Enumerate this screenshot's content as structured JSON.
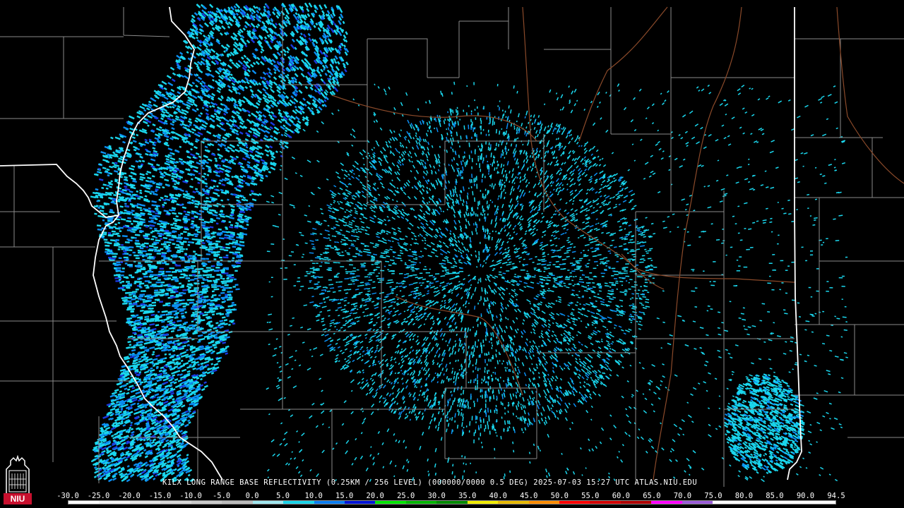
{
  "caption": "KILX LONG RANGE BASE REFLECTIVITY (0.25KM / 256 LEVEL) (000000/0000 0.5 DEG) 2025-07-03 15:27 UTC  ATLAS.NIU.EDU",
  "logo_text": "NIU",
  "scale": {
    "labels": [
      "-30.0",
      "-25.0",
      "-20.0",
      "-15.0",
      "-10.0",
      "-5.0",
      "0.0",
      "5.0",
      "10.0",
      "15.0",
      "20.0",
      "25.0",
      "30.0",
      "35.0",
      "40.0",
      "45.0",
      "50.0",
      "55.0",
      "60.0",
      "65.0",
      "70.0",
      "75.0",
      "80.0",
      "85.0",
      "90.0",
      "94.5"
    ],
    "colors": [
      "#ffffff",
      "#f2f2f2",
      "#e4e4e4",
      "#d6d6d6",
      "#c8c8c8",
      "#bababa",
      "#9fe6ee",
      "#19d2e8",
      "#0a7cf0",
      "#0014d8",
      "#00e400",
      "#00b400",
      "#008a00",
      "#f0ec00",
      "#e6b800",
      "#ff8c00",
      "#ff0000",
      "#d40000",
      "#b00000",
      "#ff00ff",
      "#9a5cd8",
      "#ffffff",
      "#ffffff",
      "#ffffff",
      "#ffffff"
    ]
  },
  "colors": {
    "background": "#000000",
    "county_lines": "#8a8a8a",
    "state_lines": "#ffffff",
    "rivers": "#8b4a2a",
    "echo_light": "#1ad7ee",
    "echo_mid": "#0b8ef2",
    "echo_dark": "#1a3ae0",
    "radar_site": "#000000"
  }
}
